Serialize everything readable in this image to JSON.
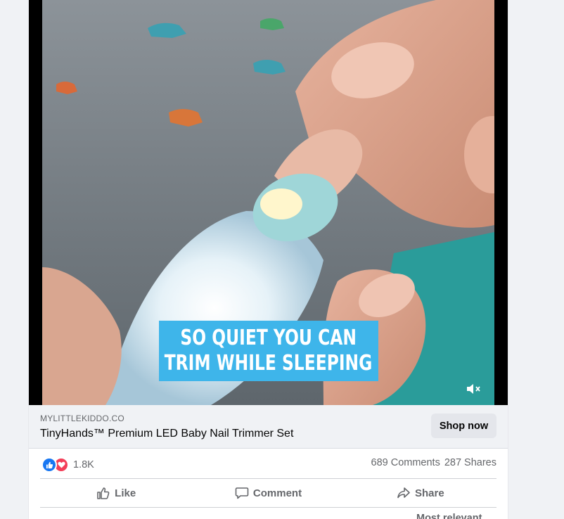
{
  "video": {
    "caption_line1": "SO QUIET YOU CAN",
    "caption_line2": "TRIM WHILE SLEEPING",
    "mute_icon": "speaker-muted-icon"
  },
  "link": {
    "domain": "MYLITTLEKIDDO.CO",
    "title": "TinyHands™ Premium LED Baby Nail Trimmer Set",
    "cta": "Shop now"
  },
  "stats": {
    "reaction_icons": [
      "like-reaction-icon",
      "love-reaction-icon"
    ],
    "reaction_count": "1.8K",
    "comments": "689 Comments",
    "shares": "287 Shares"
  },
  "actions": {
    "like": "Like",
    "comment": "Comment",
    "share": "Share"
  },
  "comments_sort": "Most relevant",
  "colors": {
    "like_blue": "#1877f2",
    "love_red": "#f33e58",
    "caption_blue": "#3eb5ea"
  }
}
